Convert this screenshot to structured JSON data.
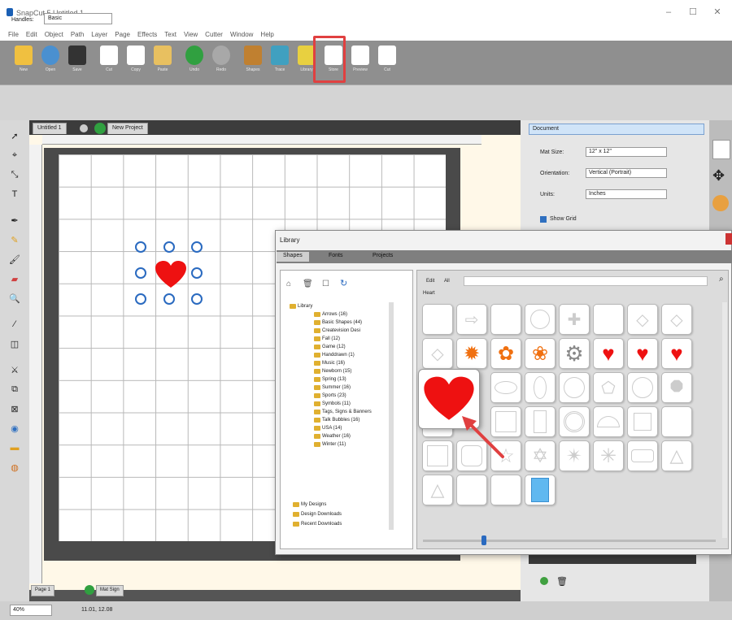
{
  "window": {
    "title": "SnapCut 5 Untitled 1",
    "minimize": "–",
    "maximize": "☐",
    "close": "✕"
  },
  "menu": [
    "File",
    "Edit",
    "Object",
    "Path",
    "Layer",
    "Page",
    "Effects",
    "Text",
    "View",
    "Cutter",
    "Window",
    "Help"
  ],
  "toolbar": {
    "buttons": [
      {
        "label": "New",
        "icon": "new-document-icon",
        "color": "#f0c040"
      },
      {
        "label": "Open",
        "icon": "open-icon",
        "color": "#4a90d0"
      },
      {
        "label": "Save",
        "icon": "save-icon",
        "color": "#333333"
      },
      {
        "label": "Cut",
        "icon": "cut-icon",
        "color": "#ffffff"
      },
      {
        "label": "Copy",
        "icon": "copy-icon",
        "color": "#ffffff"
      },
      {
        "label": "Paste",
        "icon": "paste-icon",
        "color": "#e8c060"
      },
      {
        "label": "Undo",
        "icon": "undo-icon",
        "color": "#30a040"
      },
      {
        "label": "Redo",
        "icon": "redo-icon",
        "color": "#a8a8a8"
      },
      {
        "label": "Shapes",
        "icon": "shapes-icon",
        "color": "#c08030"
      },
      {
        "label": "Trace",
        "icon": "trace-icon",
        "color": "#40a0c0"
      },
      {
        "label": "Library",
        "icon": "library-icon",
        "color": "#e8d040"
      },
      {
        "label": "Store",
        "icon": "store-icon",
        "color": "#ffffff"
      },
      {
        "label": "Preview",
        "icon": "preview-icon",
        "color": "#ffffff"
      },
      {
        "label": "Cut",
        "icon": "knife-icon",
        "color": "#ffffff"
      }
    ],
    "highlight_color": "#e04040"
  },
  "options": {
    "handles_label": "Handles:",
    "handles_value": "Basic"
  },
  "doc_tabs": [
    "Untitled 1",
    "New Project"
  ],
  "tools": [
    "select-arrow-icon",
    "node-edit-icon",
    "transform-icon",
    "text-icon",
    "pen-icon",
    "pencil-icon",
    "brush-icon",
    "eraser-icon",
    "zoom-icon",
    "eyedropper-icon",
    "crop-icon",
    "knife-tool-icon",
    "weld-icon",
    "shadow-icon",
    "fill-icon",
    "rhinestone-icon",
    "layer-icon",
    "color-icon"
  ],
  "properties": {
    "title": "Document",
    "mat_size_label": "Mat Size:",
    "mat_size_value": "12\" x 12\"",
    "orientation_label": "Orientation:",
    "orientation_value": "Vertical (Portrait)",
    "units_label": "Units:",
    "units_value": "Inches",
    "show_grid_label": "Show Grid"
  },
  "library": {
    "title": "Library",
    "tabs": [
      "Shapes",
      "Fonts",
      "Projects"
    ],
    "filter": {
      "edit": "Edit",
      "all": "All"
    },
    "category_label": "Heart",
    "tree": [
      "Library",
      "Arrows (16)",
      "Basic Shapes (44)",
      "Createvision Desi",
      "Fall (12)",
      "Game (12)",
      "Handdrawn (1)",
      "Music (16)",
      "Newborn (15)",
      "Spring (13)",
      "Summer (16)",
      "Sports (23)",
      "Symbols (11)",
      "Tags, Signs & Banners",
      "Talk Bubbles (16)",
      "USA (14)",
      "Weather (16)",
      "Winter (11)",
      "My Designs",
      "Design Downloads",
      "Recent Downloads"
    ],
    "tiles": [
      "arc",
      "arrow",
      "cross-blob",
      "circle",
      "plus",
      "rounded-rect",
      "diamond",
      "octagon",
      "diamond-outline",
      "sun-orange",
      "flower-orange",
      "flower-orange-2",
      "gear-gray",
      "heart-red",
      "heart-red-2",
      "heart-red-3",
      "heart-pointer",
      "ellipse",
      "oval-tall",
      "circle-2",
      "pentagon",
      "circle-3",
      "octagon-2",
      "square",
      "rect-split",
      "rect-tall",
      "ring",
      "half-circle",
      "square-inset",
      "blank",
      "square-2",
      "square-concave",
      "star-5",
      "star-6",
      "star-8",
      "badge",
      "triangle",
      "triangle-2",
      "blank-2",
      "blank-3",
      "square-blue"
    ]
  },
  "page_tab": {
    "label": "Page 1",
    "name": "Mat Sign"
  },
  "status": {
    "zoom": "40%",
    "coords": "11.01, 12.08"
  }
}
